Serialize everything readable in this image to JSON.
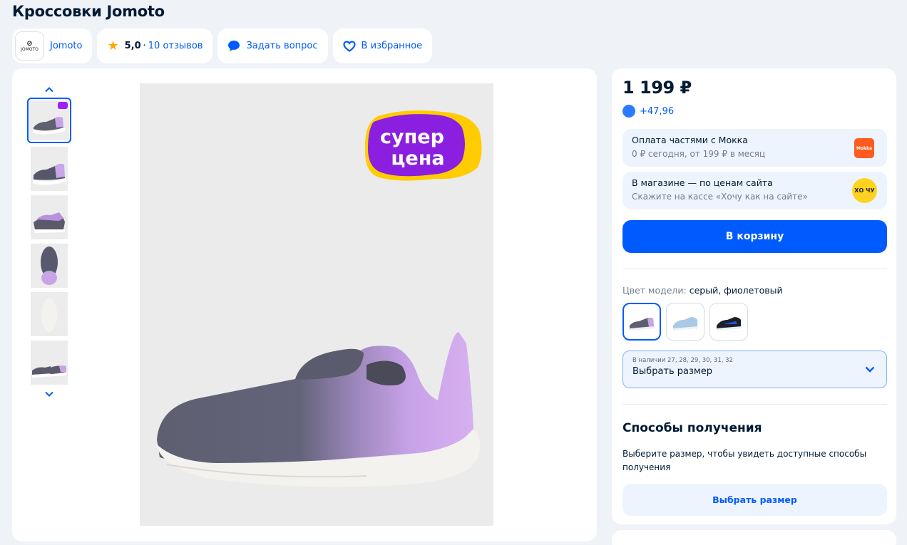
{
  "product": {
    "title": "Кроссовки Jomoto"
  },
  "chips": {
    "brand_logo_text": "JOMOTO",
    "brand_name": "Jomoto",
    "rating": "5,0",
    "reviews": "10 отзывов",
    "ask_question": "Задать вопрос",
    "favorite": "В избранное"
  },
  "gallery": {
    "badge_line1": "супер",
    "badge_line2": "цена",
    "thumbnail_count": 6
  },
  "buy": {
    "price": "1 199 ₽",
    "bonus": "+47,96",
    "installment_title": "Оплата частями с Мокка",
    "installment_sub": "0 ₽ сегодня, от 199 ₽ в месяц",
    "mokka_logo": "Mokka",
    "store_title": "В магазине — по ценам сайта",
    "store_sub": "Скажите на кассе «Хочу как на сайте»",
    "hochu_logo": "ХО ЧУ",
    "cart_button": "В корзину",
    "color_label": "Цвет модели: ",
    "color_value": "серый, фиолетовый",
    "size_available": "В наличии 27, 28, 29, 30, 31, 32",
    "size_select": "Выбрать размер",
    "delivery_title": "Способы получения",
    "delivery_text": "Выберите размер, чтобы увидеть доступные способы получения",
    "pick_size_button": "Выбрать размер"
  },
  "colors": {
    "accent": "#005bff",
    "background": "#eff3f8",
    "badge_purple": "#8a1fe0",
    "badge_yellow": "#ffcc00"
  }
}
